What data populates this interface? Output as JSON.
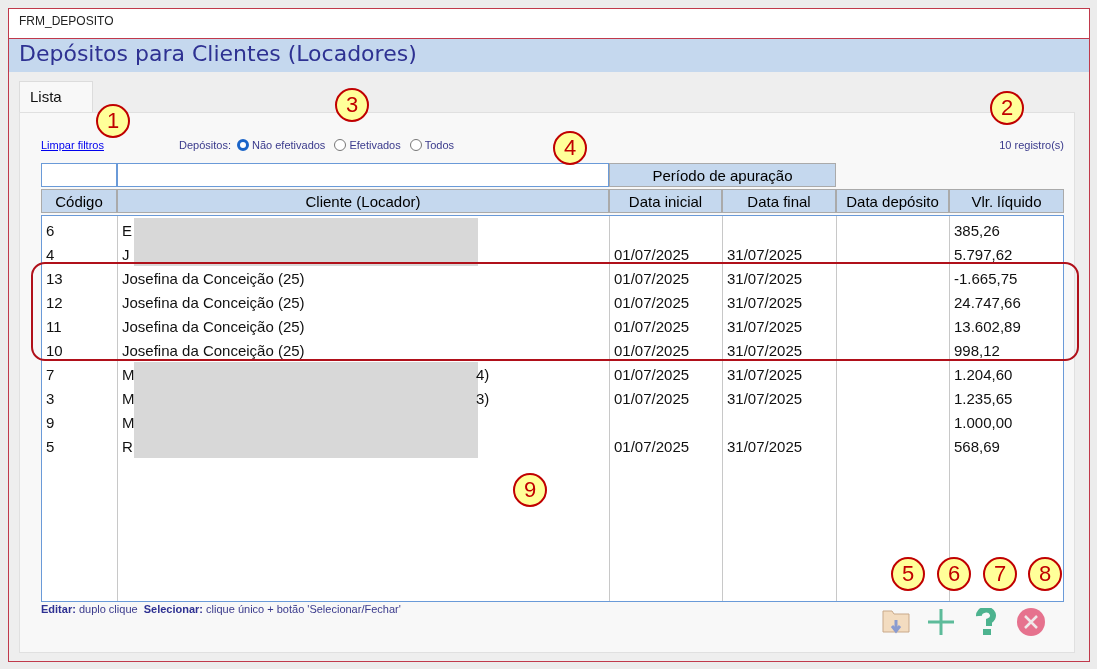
{
  "window": {
    "title": "FRM_DEPOSITO"
  },
  "header": {
    "title": "Depósitos para Clientes (Locadores)"
  },
  "tabs": [
    {
      "label": "Lista",
      "selected": true
    }
  ],
  "filters": {
    "clear_link": "Limpar filtros",
    "deposits_label": "Depósitos:",
    "options": [
      {
        "label": "Não efetivados",
        "selected": true
      },
      {
        "label": "Efetivados",
        "selected": false
      },
      {
        "label": "Todos",
        "selected": false
      }
    ],
    "record_count": "10 registro(s)"
  },
  "table": {
    "group_header": "Período de apuração",
    "columns": [
      "Código",
      "Cliente (Locador)",
      "Data inicial",
      "Data final",
      "Data depósito",
      "Vlr. líquido"
    ],
    "rows": [
      {
        "code": "6",
        "client": "E",
        "client_tail": "",
        "start": "",
        "end": "",
        "deposit": "",
        "value": "385,26",
        "highlighted": false,
        "redacted": true
      },
      {
        "code": "4",
        "client": "J",
        "client_tail": "",
        "start": "01/07/2025",
        "end": "31/07/2025",
        "deposit": "",
        "value": "5.797,62",
        "highlighted": false,
        "redacted": true
      },
      {
        "code": "13",
        "client": "Josefina da Conceição (25)",
        "client_tail": "",
        "start": "01/07/2025",
        "end": "31/07/2025",
        "deposit": "",
        "value": "-1.665,75",
        "highlighted": true,
        "redacted": false
      },
      {
        "code": "12",
        "client": "Josefina da Conceição (25)",
        "client_tail": "",
        "start": "01/07/2025",
        "end": "31/07/2025",
        "deposit": "",
        "value": "24.747,66",
        "highlighted": true,
        "redacted": false
      },
      {
        "code": "11",
        "client": "Josefina da Conceição (25)",
        "client_tail": "",
        "start": "01/07/2025",
        "end": "31/07/2025",
        "deposit": "",
        "value": "13.602,89",
        "highlighted": true,
        "redacted": false
      },
      {
        "code": "10",
        "client": "Josefina da Conceição (25)",
        "client_tail": "",
        "start": "01/07/2025",
        "end": "31/07/2025",
        "deposit": "",
        "value": "998,12",
        "highlighted": true,
        "redacted": false
      },
      {
        "code": "7",
        "client": "M",
        "client_tail": "4)",
        "start": "01/07/2025",
        "end": "31/07/2025",
        "deposit": "",
        "value": "1.204,60",
        "highlighted": false,
        "redacted": true
      },
      {
        "code": "3",
        "client": "M",
        "client_tail": "3)",
        "start": "01/07/2025",
        "end": "31/07/2025",
        "deposit": "",
        "value": "1.235,65",
        "highlighted": false,
        "redacted": true
      },
      {
        "code": "9",
        "client": "M",
        "client_tail": "",
        "start": "",
        "end": "",
        "deposit": "",
        "value": "1.000,00",
        "highlighted": false,
        "redacted": true
      },
      {
        "code": "5",
        "client": "R",
        "client_tail": "",
        "start": "01/07/2025",
        "end": "31/07/2025",
        "deposit": "",
        "value": "568,69",
        "highlighted": false,
        "redacted": true
      }
    ]
  },
  "footer_hint": "**Editar:** duplo clique  **Selecionar:** clique único + botão 'Selecionar/Fechar'",
  "buttons": [
    {
      "kind": "folder"
    },
    {
      "kind": "add"
    },
    {
      "kind": "help"
    },
    {
      "kind": "close"
    }
  ],
  "callouts": [
    "1",
    "2",
    "3",
    "4",
    "5",
    "6",
    "7",
    "8",
    "9"
  ]
}
